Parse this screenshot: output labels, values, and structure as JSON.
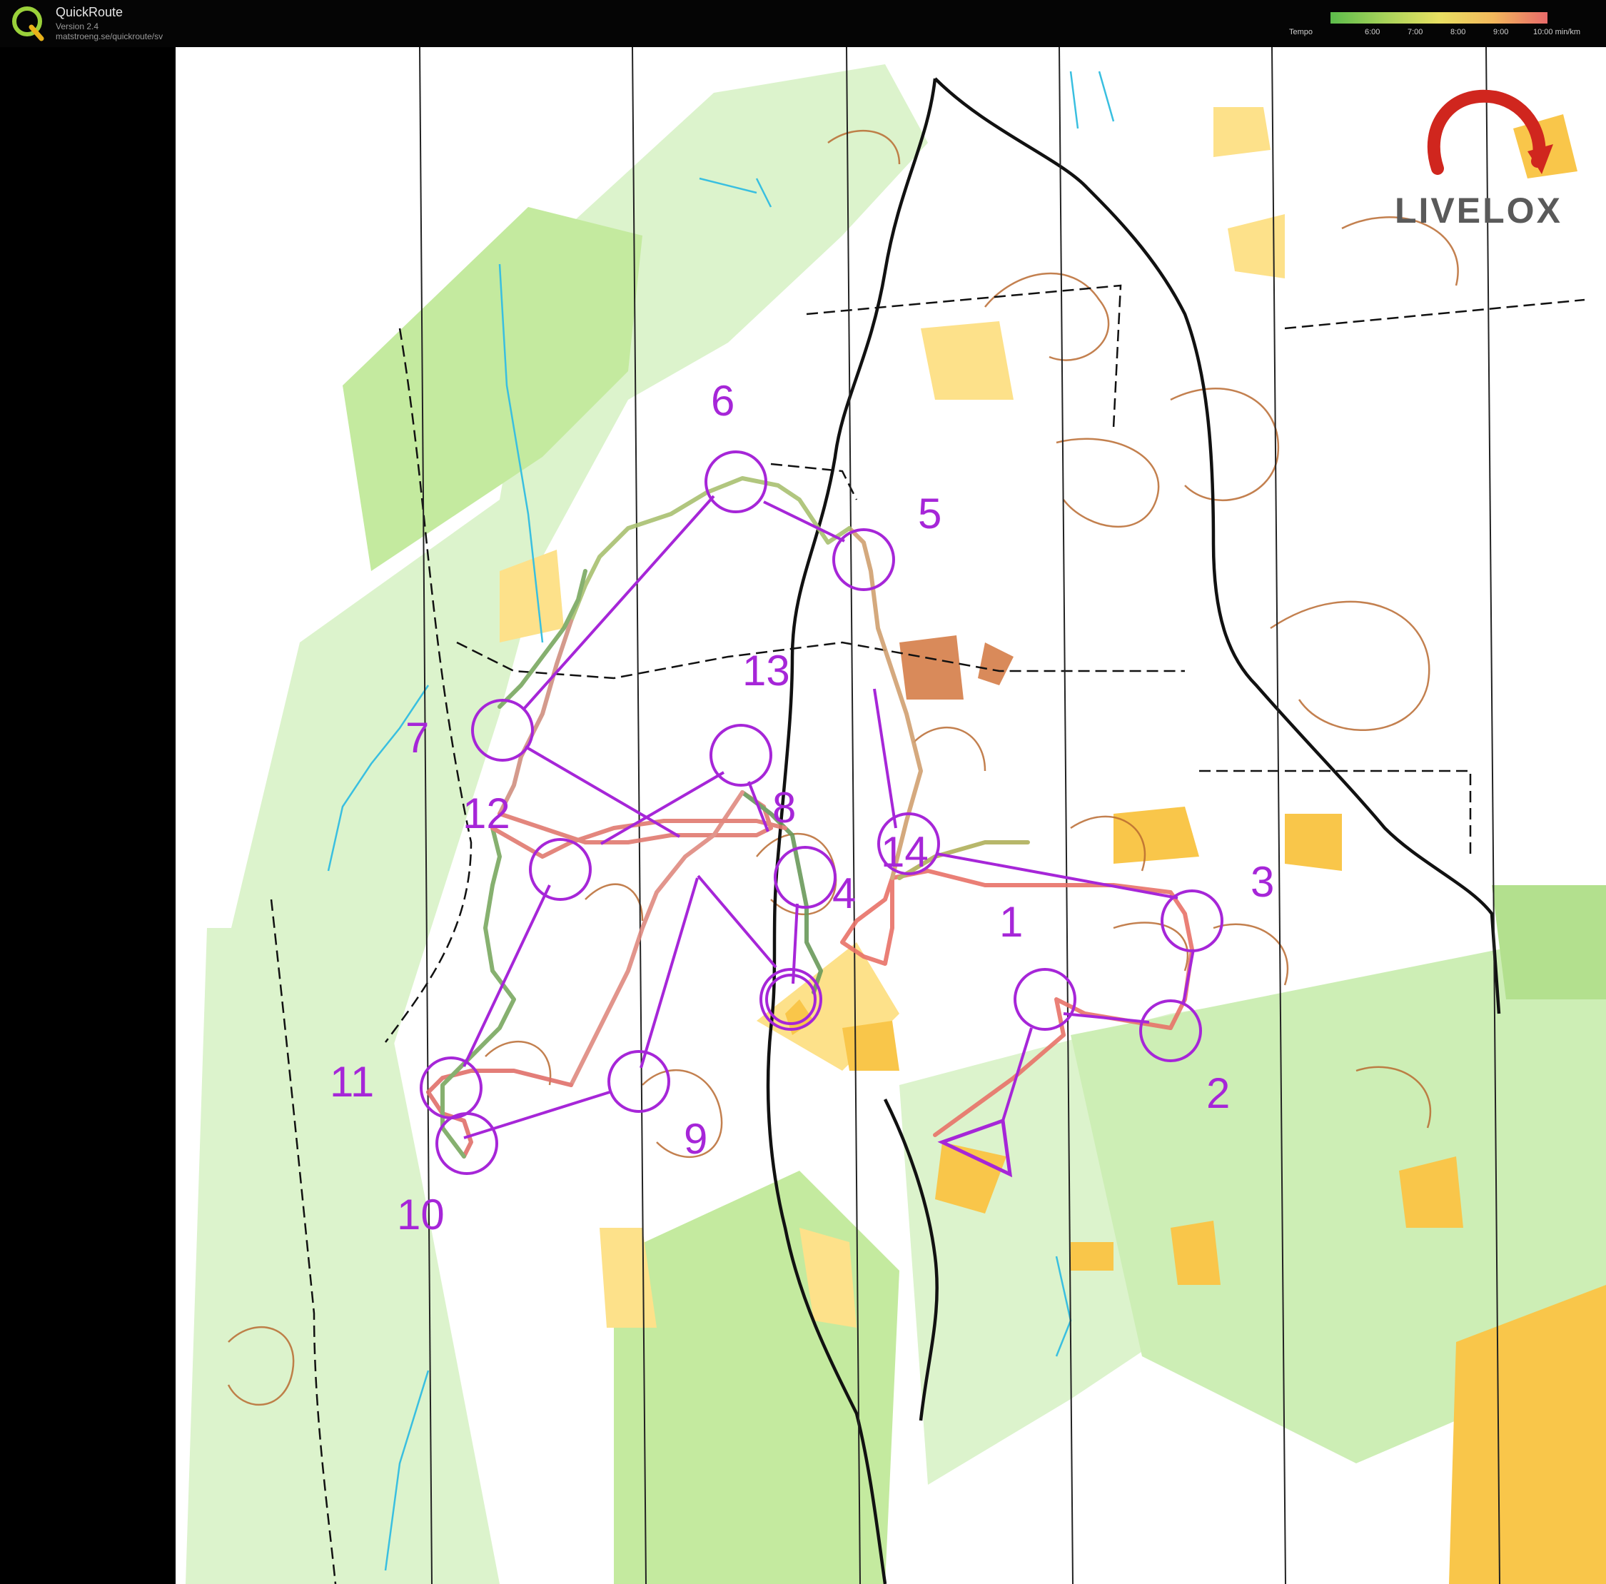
{
  "app": {
    "name": "QuickRoute",
    "version": "Version 2.4",
    "url": "matstroeng.se/quickroute/sv"
  },
  "tempo_legend": {
    "label": "Tempo",
    "ticks": [
      "6:00",
      "7:00",
      "8:00",
      "9:00",
      "10:00  min/km"
    ],
    "colors": [
      "#5cbc4b",
      "#a7d35a",
      "#e8e062",
      "#f3b85c",
      "#e86a6a"
    ]
  },
  "watermark": {
    "text": "LIVELOX"
  },
  "course": {
    "color": "#a626d8",
    "controls": [
      {
        "number": "1"
      },
      {
        "number": "2"
      },
      {
        "number": "3"
      },
      {
        "number": "4"
      },
      {
        "number": "5"
      },
      {
        "number": "6"
      },
      {
        "number": "7"
      },
      {
        "number": "8"
      },
      {
        "number": "9"
      },
      {
        "number": "10"
      },
      {
        "number": "11"
      },
      {
        "number": "12"
      },
      {
        "number": "13"
      },
      {
        "number": "14"
      }
    ]
  },
  "map_colors": {
    "open_land": "#fde18a",
    "rough_open": "#f9c64a",
    "light_green": "#d8f2c6",
    "green": "#a9dc86",
    "contour": "#b96a30",
    "track": "#111111",
    "water": "#39bfe0"
  }
}
